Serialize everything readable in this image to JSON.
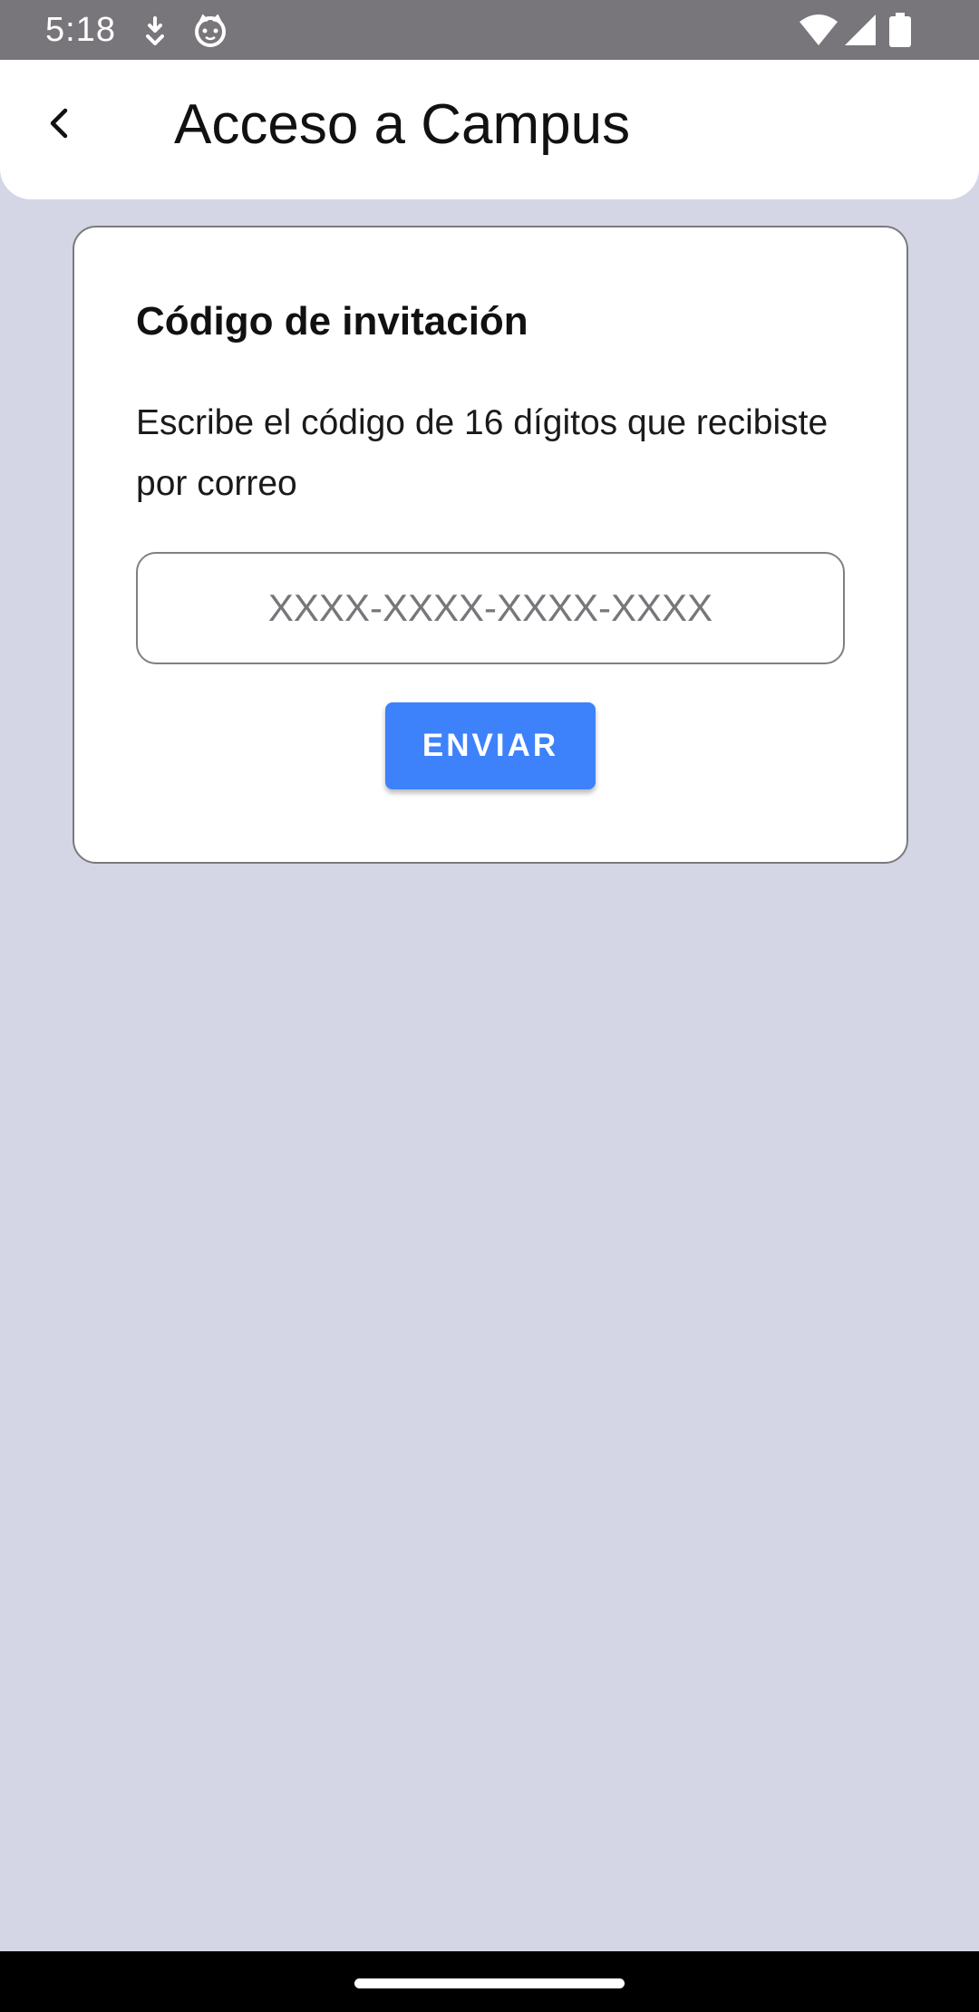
{
  "status_bar": {
    "time": "5:18",
    "icons": [
      "download-icon",
      "cat-icon",
      "wifi-icon",
      "signal-icon",
      "battery-icon"
    ]
  },
  "app_bar": {
    "title": "Acceso a Campus",
    "back_icon": "chevron-left-icon"
  },
  "card": {
    "title": "Código de invitación",
    "description": "Escribe el código de 16 dígitos que recibiste por correo",
    "input": {
      "value": "",
      "placeholder": "XXXX-XXXX-XXXX-XXXX"
    },
    "submit_label": "ENVIAR"
  },
  "colors": {
    "status_bar_bg": "#78767b",
    "page_bg": "#d4d5e5",
    "accent": "#3d82fb",
    "nav_bar_bg": "#000000"
  }
}
